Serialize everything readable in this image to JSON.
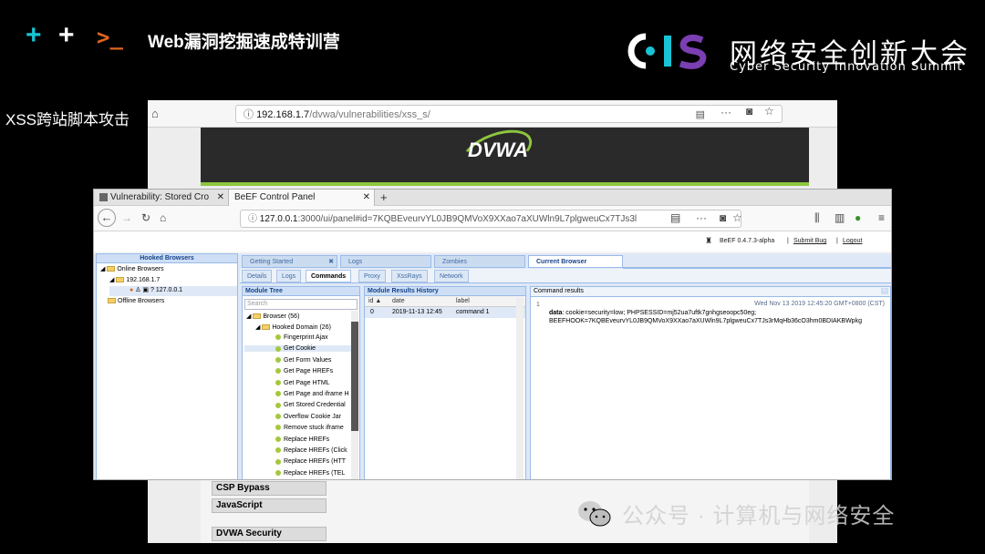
{
  "header": {
    "title": "Web漏洞挖掘速成特训营",
    "plus_glyph": "+",
    "prompt_glyph": ">_",
    "brand_cn": "网络安全创新大会",
    "brand_en": "Cyber Security Innovation Summit",
    "side_label": "XSS跨站脚本攻击"
  },
  "back_browser": {
    "url_host": "192.168.1.7",
    "url_path": "/dvwa/vulnerabilities/xss_s/",
    "logo": "DVWA",
    "menu": [
      "CSP Bypass",
      "JavaScript",
      "DVWA Security"
    ]
  },
  "front_browser": {
    "tabs": [
      "Vulnerability: Stored Cro",
      "BeEF Control Panel"
    ],
    "url_host": "127.0.0.1",
    "url_rest": ":3000/ui/panel#id=7KQBEveurvYL0JB9QMVoX9XXao7aXUWln9L7plgweuCx7TJs3l",
    "beef_version": "BeEF  0.4.7.3-alpha",
    "submit_bug": "Submit Bug",
    "logout": "Logout",
    "separator": "|"
  },
  "hooked": {
    "title": "Hooked Browsers",
    "online": "Online Browsers",
    "ip": "192.168.1.7",
    "question": "?",
    "host": "127.0.0.1",
    "offline": "Offline Browsers"
  },
  "top_tabs": [
    "Getting Started",
    "Logs",
    "Zombies",
    "Current Browser"
  ],
  "sub_tabs": [
    "Details",
    "Logs",
    "Commands",
    "Proxy",
    "XssRays",
    "Network"
  ],
  "module_tree": {
    "title": "Module Tree",
    "search_placeholder": "Search",
    "browser": "Browser (56)",
    "hooked_domain": "Hooked Domain (26)",
    "items": [
      "Fingerprint Ajax",
      "Get Cookie",
      "Get Form Values",
      "Get Page HREFs",
      "Get Page HTML",
      "Get Page and iframe H",
      "Get Stored Credential",
      "Overflow Cookie Jar",
      "Remove stuck iframe",
      "Replace HREFs",
      "Replace HREFs (Click",
      "Replace HREFs (HTT",
      "Replace HREFs (TEL"
    ]
  },
  "results": {
    "title": "Module Results History",
    "col_id": "id",
    "col_date": "date",
    "col_label": "label",
    "row": {
      "id": "0",
      "date": "2019-11-13 12:45",
      "label": "command 1"
    }
  },
  "command": {
    "title": "Command results",
    "index": "1",
    "timestamp": "Wed Nov 13 2019 12:45:20 GMT+0800 (CST)",
    "data_label": "data",
    "data_line1": ": cookie=security=low; PHPSESSID=mj52ua7uftk7gnhgseoopc50eg;",
    "data_line2": "BEEFHOOK=7KQBEveurvYL0JB9QMVoX9XXao7aXUWln9L7plgweuCx7TJs3rMqHb36cO3hm0BDIAKBWpkg"
  },
  "watermark": "公众号 · 计算机与网络安全",
  "colors": {
    "accent_cyan": "#19c3d6",
    "accent_orange": "#e0661e",
    "cis_purple": "#7b3fb3",
    "beef_blue": "#15428b"
  }
}
